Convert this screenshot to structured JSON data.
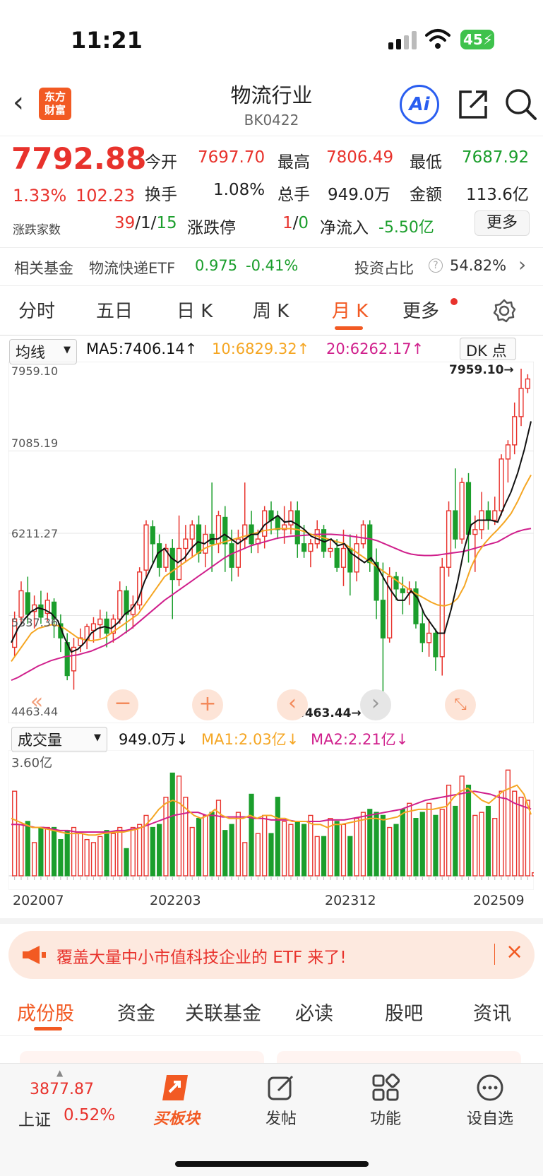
{
  "status": {
    "time": "11:21",
    "battery": "45"
  },
  "header": {
    "title": "物流行业",
    "code": "BK0422",
    "logo_text": "东方\n财富",
    "ai_label": "Ai"
  },
  "quote": {
    "price": "7792.88",
    "pct": "1.33%",
    "chg": "102.23",
    "open_label": "今开",
    "open": "7697.70",
    "high_label": "最高",
    "high": "7806.49",
    "low_label": "最低",
    "low": "7687.92",
    "turnover_label": "换手",
    "turnover": "1.08%",
    "volume_label": "总手",
    "volume": "949.0万",
    "amount_label": "金额",
    "amount": "113.6亿",
    "updown_label": "涨跌家数",
    "up": "39",
    "flat": "1",
    "down": "15",
    "limit_label": "涨跌停",
    "limit_up": "1",
    "limit_down": "0",
    "netflow_label": "净流入",
    "netflow": "-5.50亿",
    "more": "更多"
  },
  "fund": {
    "label": "相关基金",
    "name": "物流快递ETF",
    "price": "0.975",
    "chg": "-0.41%",
    "ratio_label": "投资占比",
    "ratio": "54.82%"
  },
  "tabs": [
    "分时",
    "五日",
    "日 K",
    "周 K",
    "月 K",
    "更多"
  ],
  "active_tab": 4,
  "indicator": {
    "select": "均线",
    "ma5": "MA5:7406.14",
    "ma10": "10:6829.32",
    "ma20": "20:6262.17",
    "dk": "DK 点"
  },
  "volume_ind": {
    "select": "成交量",
    "vol": "949.0万",
    "ma1": "MA1:2.03亿",
    "ma2": "MA2:2.21亿",
    "ymax": "3.60亿"
  },
  "chart_data": {
    "type": "candlestick",
    "ylim": [
      4463.44,
      7959.1
    ],
    "yticks": [
      "7959.10",
      "7085.19",
      "6211.27",
      "5337.36",
      "4463.44"
    ],
    "high_mark": "7959.10→",
    "low_mark": "4463.44→",
    "xticks": [
      "202007",
      "202203",
      "202312",
      "202509"
    ],
    "candles": [
      [
        5000,
        5300,
        4900,
        5380
      ],
      [
        5320,
        5600,
        5250,
        5700
      ],
      [
        5580,
        5350,
        5250,
        5750
      ],
      [
        5380,
        5450,
        5200,
        5550
      ],
      [
        5450,
        5320,
        5250,
        5600
      ],
      [
        5360,
        5500,
        5280,
        5580
      ],
      [
        5480,
        5300,
        5100,
        5520
      ],
      [
        5250,
        5100,
        4950,
        5350
      ],
      [
        5050,
        4700,
        4650,
        5150
      ],
      [
        4750,
        5000,
        4550,
        5100
      ],
      [
        5020,
        5100,
        4950,
        5200
      ],
      [
        5080,
        5220,
        4980,
        5250
      ],
      [
        5180,
        5250,
        5050,
        5320
      ],
      [
        5240,
        5300,
        5100,
        5400
      ],
      [
        5300,
        5150,
        5000,
        5380
      ],
      [
        5150,
        5300,
        5050,
        5350
      ],
      [
        5300,
        5600,
        5250,
        5700
      ],
      [
        5600,
        5350,
        5150,
        5650
      ],
      [
        5350,
        5450,
        5200,
        5550
      ],
      [
        5450,
        5800,
        5400,
        5850
      ],
      [
        5820,
        6300,
        5750,
        6350
      ],
      [
        6280,
        6100,
        5900,
        6350
      ],
      [
        6100,
        5850,
        5750,
        6200
      ],
      [
        5850,
        6050,
        5800,
        6100
      ],
      [
        6050,
        5720,
        5300,
        6150
      ],
      [
        5720,
        6050,
        5650,
        6400
      ],
      [
        6050,
        6150,
        5900,
        6300
      ],
      [
        6150,
        6300,
        5950,
        6350
      ],
      [
        6300,
        6000,
        5900,
        6400
      ],
      [
        6000,
        6200,
        5850,
        6300
      ],
      [
        6200,
        6100,
        5800,
        6750
      ],
      [
        6100,
        6400,
        6000,
        6450
      ],
      [
        6380,
        6100,
        5800,
        6500
      ],
      [
        6100,
        5850,
        5700,
        6250
      ],
      [
        5850,
        6150,
        5750,
        6250
      ],
      [
        6150,
        6300,
        6050,
        6750
      ],
      [
        6300,
        6100,
        6000,
        6450
      ],
      [
        6100,
        6150,
        6000,
        6250
      ],
      [
        6180,
        6450,
        6050,
        6500
      ],
      [
        6450,
        6350,
        6200,
        6550
      ],
      [
        6380,
        6250,
        6150,
        6450
      ],
      [
        6250,
        6300,
        6100,
        6500
      ],
      [
        6300,
        6450,
        6200,
        6550
      ],
      [
        6450,
        6100,
        5950,
        6550
      ],
      [
        6100,
        6020,
        5950,
        6300
      ],
      [
        6020,
        6100,
        5850,
        6150
      ],
      [
        6100,
        6250,
        6050,
        6350
      ],
      [
        6250,
        6020,
        5950,
        6300
      ],
      [
        6020,
        6050,
        5950,
        6150
      ],
      [
        6050,
        5850,
        5800,
        6150
      ],
      [
        5850,
        6050,
        5650,
        6250
      ],
      [
        6050,
        5800,
        5550,
        6200
      ],
      [
        5800,
        6100,
        5700,
        6200
      ],
      [
        6100,
        6300,
        6050,
        6350
      ],
      [
        6300,
        5900,
        5800,
        6350
      ],
      [
        5900,
        5500,
        5300,
        6050
      ],
      [
        5500,
        5100,
        4463,
        5900
      ],
      [
        5100,
        5750,
        5050,
        5850
      ],
      [
        5750,
        5620,
        5500,
        5800
      ],
      [
        5620,
        5580,
        5350,
        5750
      ],
      [
        5580,
        5620,
        5450,
        5700
      ],
      [
        5620,
        5250,
        5200,
        5700
      ],
      [
        5250,
        5050,
        4950,
        5400
      ],
      [
        5050,
        5150,
        4900,
        5300
      ],
      [
        5150,
        4900,
        4750,
        5200
      ],
      [
        4900,
        5850,
        4700,
        5950
      ],
      [
        5850,
        6450,
        5750,
        6550
      ],
      [
        6450,
        6150,
        6050,
        6900
      ],
      [
        6150,
        6750,
        6100,
        6800
      ],
      [
        6750,
        6200,
        5900,
        6850
      ],
      [
        6200,
        6250,
        5800,
        6400
      ],
      [
        6250,
        6450,
        6150,
        6650
      ],
      [
        6450,
        6350,
        6250,
        6550
      ],
      [
        6350,
        6450,
        6300,
        6600
      ],
      [
        6450,
        7000,
        6400,
        7050
      ],
      [
        7000,
        7150,
        6750,
        7200
      ],
      [
        7150,
        7450,
        7050,
        7600
      ],
      [
        7450,
        7750,
        7350,
        7959
      ],
      [
        7750,
        7850,
        7700,
        7900
      ]
    ],
    "ma5": [
      5050,
      5200,
      5300,
      5380,
      5420,
      5400,
      5360,
      5280,
      5100,
      4950,
      4980,
      5050,
      5150,
      5200,
      5220,
      5200,
      5260,
      5350,
      5400,
      5500,
      5700,
      5850,
      6000,
      6050,
      5950,
      5900,
      5950,
      6050,
      6120,
      6100,
      6150,
      6150,
      6200,
      6150,
      6100,
      6150,
      6200,
      6200,
      6300,
      6350,
      6400,
      6330,
      6340,
      6300,
      6250,
      6180,
      6150,
      6120,
      6150,
      6080,
      6100,
      6000,
      5950,
      5900,
      5950,
      5850,
      5720,
      5600,
      5500,
      5500,
      5600,
      5520,
      5350,
      5250,
      5150,
      5150,
      5400,
      5700,
      6050,
      6300,
      6350,
      6350,
      6350,
      6330,
      6500,
      6650,
      6850,
      7100,
      7400
    ],
    "ma10": [
      4850,
      4950,
      5050,
      5150,
      5200,
      5220,
      5240,
      5230,
      5200,
      5150,
      5100,
      5080,
      5070,
      5080,
      5100,
      5150,
      5200,
      5250,
      5300,
      5350,
      5450,
      5550,
      5650,
      5750,
      5800,
      5850,
      5900,
      5950,
      6000,
      6050,
      6080,
      6100,
      6120,
      6140,
      6160,
      6180,
      6200,
      6220,
      6240,
      6250,
      6260,
      6260,
      6260,
      6250,
      6230,
      6200,
      6180,
      6160,
      6140,
      6120,
      6100,
      6050,
      6000,
      5950,
      5900,
      5850,
      5800,
      5750,
      5700,
      5650,
      5600,
      5560,
      5520,
      5480,
      5450,
      5440,
      5460,
      5520,
      5650,
      5850,
      6000,
      6100,
      6180,
      6250,
      6330,
      6420,
      6550,
      6700,
      6830
    ],
    "ma20": [
      4650,
      4680,
      4720,
      4760,
      4800,
      4830,
      4860,
      4880,
      4900,
      4910,
      4920,
      4940,
      4960,
      4990,
      5020,
      5060,
      5100,
      5150,
      5200,
      5260,
      5320,
      5380,
      5440,
      5500,
      5550,
      5600,
      5650,
      5700,
      5750,
      5800,
      5850,
      5900,
      5950,
      5990,
      6020,
      6050,
      6080,
      6100,
      6120,
      6140,
      6160,
      6170,
      6180,
      6185,
      6190,
      6195,
      6200,
      6200,
      6200,
      6195,
      6190,
      6180,
      6170,
      6160,
      6150,
      6130,
      6100,
      6070,
      6040,
      6010,
      5990,
      5980,
      5975,
      5975,
      5980,
      5990,
      6000,
      6010,
      6020,
      6040,
      6060,
      6080,
      6100,
      6120,
      6160,
      6200,
      6230,
      6250,
      6262
    ],
    "vol": [
      2.8,
      1.7,
      1.8,
      1.1,
      1.6,
      1.6,
      1.6,
      1.2,
      1.5,
      1.6,
      1.4,
      1.2,
      1.1,
      1.3,
      1.5,
      1.4,
      1.6,
      0.9,
      1.6,
      1.7,
      2.0,
      1.6,
      1.7,
      2.6,
      3.4,
      3.3,
      2.6,
      1.6,
      1.9,
      2.0,
      2.1,
      2.5,
      1.5,
      1.7,
      2.1,
      1.1,
      2.7,
      1.4,
      2.0,
      1.4,
      2.6,
      1.8,
      1.7,
      1.8,
      1.7,
      2.0,
      1.3,
      1.3,
      1.9,
      1.8,
      1.7,
      1.3,
      1.9,
      2.1,
      2.2,
      2.1,
      2.0,
      1.6,
      1.7,
      2.2,
      2.4,
      1.9,
      2.1,
      2.4,
      2.0,
      2.2,
      3.0,
      2.3,
      3.3,
      3.0,
      2.0,
      2.1,
      2.3,
      1.9,
      2.8,
      3.5,
      2.8,
      2.6,
      2.5,
      0.1
    ],
    "vol_ma1": [
      1.9,
      1.8,
      1.7,
      1.6,
      1.6,
      1.55,
      1.5,
      1.45,
      1.4,
      1.4,
      1.4,
      1.35,
      1.35,
      1.4,
      1.42,
      1.45,
      1.45,
      1.5,
      1.55,
      1.65,
      1.9,
      2.2,
      2.4,
      2.5,
      2.4,
      2.2,
      2.0,
      1.9,
      2.0,
      2.2,
      2.0,
      1.9,
      1.9,
      1.9,
      2.0,
      1.9,
      2.0,
      2.0,
      1.9,
      1.9,
      1.8,
      1.8,
      1.8,
      1.7,
      1.7,
      1.6,
      1.7,
      1.7,
      1.75,
      1.8,
      1.85,
      1.9,
      1.9,
      1.85,
      1.9,
      1.95,
      2.1,
      2.15,
      2.2,
      2.2,
      2.2,
      2.25,
      2.3,
      2.6,
      2.8,
      2.9,
      2.7,
      2.5,
      2.4,
      2.6,
      2.8,
      2.9,
      3.0,
      2.7,
      2.03
    ],
    "vol_ma2": [
      1.7,
      1.7,
      1.65,
      1.6,
      1.6,
      1.55,
      1.5,
      1.5,
      1.45,
      1.45,
      1.45,
      1.45,
      1.45,
      1.5,
      1.5,
      1.55,
      1.6,
      1.7,
      1.8,
      1.9,
      2.0,
      2.05,
      2.1,
      2.1,
      2.0,
      2.0,
      1.95,
      1.95,
      1.95,
      1.95,
      1.9,
      1.9,
      1.85,
      1.85,
      1.85,
      1.8,
      1.8,
      1.8,
      1.8,
      1.85,
      1.85,
      1.85,
      1.9,
      1.95,
      2.0,
      2.05,
      2.1,
      2.15,
      2.2,
      2.3,
      2.4,
      2.5,
      2.55,
      2.6,
      2.65,
      2.7,
      2.75,
      2.8,
      2.75,
      2.7,
      2.6,
      2.55,
      2.4,
      2.3,
      2.21
    ]
  },
  "banner": {
    "text": "覆盖大量中小市值科技企业的 ETF 来了!"
  },
  "bottom_tabs": [
    "成份股",
    "资金",
    "关联基金",
    "必读",
    "股吧",
    "资讯"
  ],
  "dock": {
    "index_value": "3877.87",
    "index_name": "上证",
    "index_pct": "0.52%",
    "items": [
      "买板块",
      "发帖",
      "功能",
      "设自选"
    ]
  },
  "colors": {
    "up": "#e8322c",
    "down": "#1b9e2c",
    "accent": "#f25a23",
    "ma5": "#111111",
    "ma10": "#f5a623",
    "ma20": "#d0208c"
  }
}
